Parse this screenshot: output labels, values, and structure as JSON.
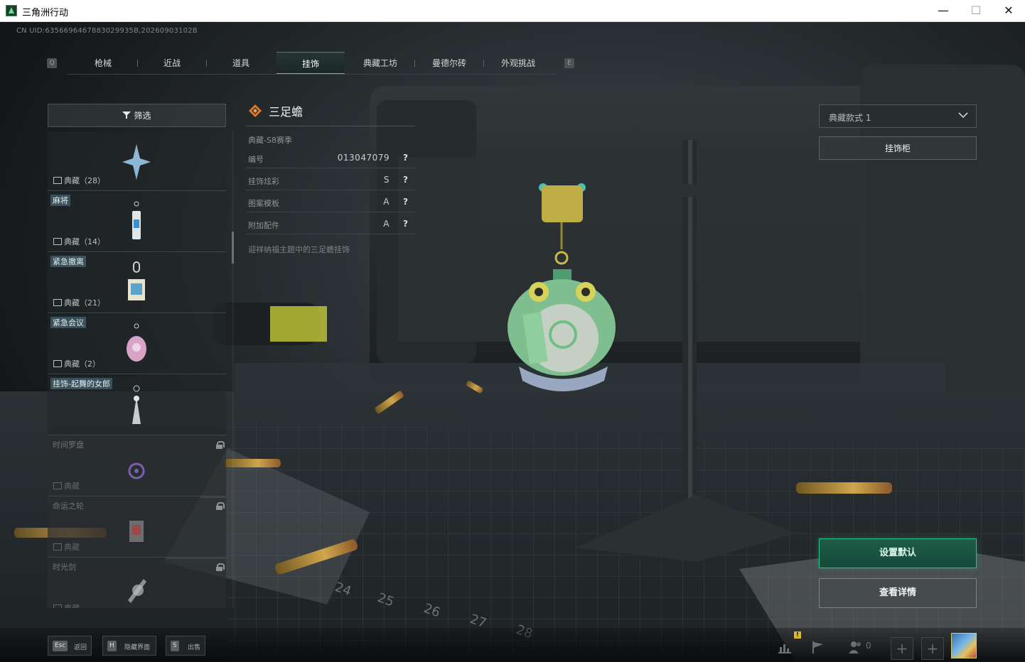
{
  "window": {
    "title": "三角洲行动",
    "minimize": "—",
    "maximize": "☐",
    "close": "✕"
  },
  "uid_text": "CN UID:6356696467883029935B,20260903102B",
  "nav": {
    "left_key": "Q",
    "right_key": "E",
    "tabs": [
      "枪械",
      "近战",
      "道具",
      "挂饰",
      "典藏工坊",
      "曼德尔砖",
      "外观挑战"
    ],
    "active_index": 3
  },
  "filter": {
    "label": "筛选"
  },
  "list": [
    {
      "name": "",
      "tier": "典藏（28）",
      "locked": false
    },
    {
      "name": "麻将",
      "tier": "典藏（14）",
      "locked": false
    },
    {
      "name": "紧急撤离",
      "tier": "典藏（21）",
      "locked": false
    },
    {
      "name": "紧急会议",
      "tier": "典藏（2）",
      "locked": false
    },
    {
      "name": "挂饰-起舞的女郎",
      "tier": "",
      "locked": false
    },
    {
      "name": "时间罗盘",
      "tier": "典藏",
      "locked": true
    },
    {
      "name": "命运之轮",
      "tier": "典藏",
      "locked": true
    },
    {
      "name": "时光剑",
      "tier": "典藏",
      "locked": true
    }
  ],
  "detail": {
    "title": "三足蟾",
    "season": "典藏-S8赛季",
    "props": [
      {
        "label": "编号",
        "value": "013047079",
        "help": "?"
      },
      {
        "label": "挂饰炫彩",
        "value": "S",
        "help": "?"
      },
      {
        "label": "图案模板",
        "value": "A",
        "help": "?"
      },
      {
        "label": "附加配件",
        "value": "A",
        "help": "?"
      }
    ],
    "description": "迎祥纳福主题中的三足蟾挂饰"
  },
  "right": {
    "style_select": "典藏款式 1",
    "cabinet": "挂饰柜",
    "set_default": "设置默认",
    "view_details": "查看详情"
  },
  "bottom": {
    "hints": [
      {
        "key": "Esc",
        "label": "返回"
      },
      {
        "key": "H",
        "label": "隐藏界面"
      },
      {
        "key": "S",
        "label": "出售"
      }
    ],
    "badge": "!",
    "friends_count": "0",
    "add": "+"
  },
  "colors": {
    "accent": "#34d49b",
    "primary_button": "#1d5d48",
    "tag_bg": "#50788c"
  }
}
